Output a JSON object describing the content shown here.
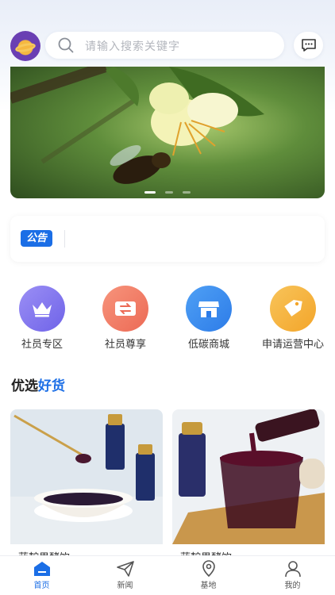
{
  "header": {
    "search_placeholder": "请输入搜索关键字",
    "avatar_icon": "app-logo-icon",
    "message_icon": "chat-icon"
  },
  "banner": {
    "slide_count": 3,
    "active_slide": 1
  },
  "notice": {
    "badge": "公告",
    "text": ""
  },
  "features": [
    {
      "label": "社员专区",
      "icon": "crown-icon",
      "color": "#8b7ff0"
    },
    {
      "label": "社员尊享",
      "icon": "exchange-icon",
      "color": "#f27f68"
    },
    {
      "label": "低碳商城",
      "icon": "store-icon",
      "color": "#3b8ff0"
    },
    {
      "label": "申请运营中心",
      "icon": "tag-icon",
      "color": "#f6b43a"
    }
  ],
  "section": {
    "title_prefix": "优选",
    "title_highlight": "好货"
  },
  "products": [
    {
      "title": "蓝靛果酵饮"
    },
    {
      "title": "蓝靛果酵饮"
    }
  ],
  "tabbar": [
    {
      "label": "首页",
      "icon": "home-icon",
      "active": true
    },
    {
      "label": "新闻",
      "icon": "paper-plane-icon",
      "active": false
    },
    {
      "label": "基地",
      "icon": "location-pin-icon",
      "active": false
    },
    {
      "label": "我的",
      "icon": "user-icon",
      "active": false
    }
  ],
  "colors": {
    "accent": "#1b6ee6",
    "text": "#333333"
  }
}
